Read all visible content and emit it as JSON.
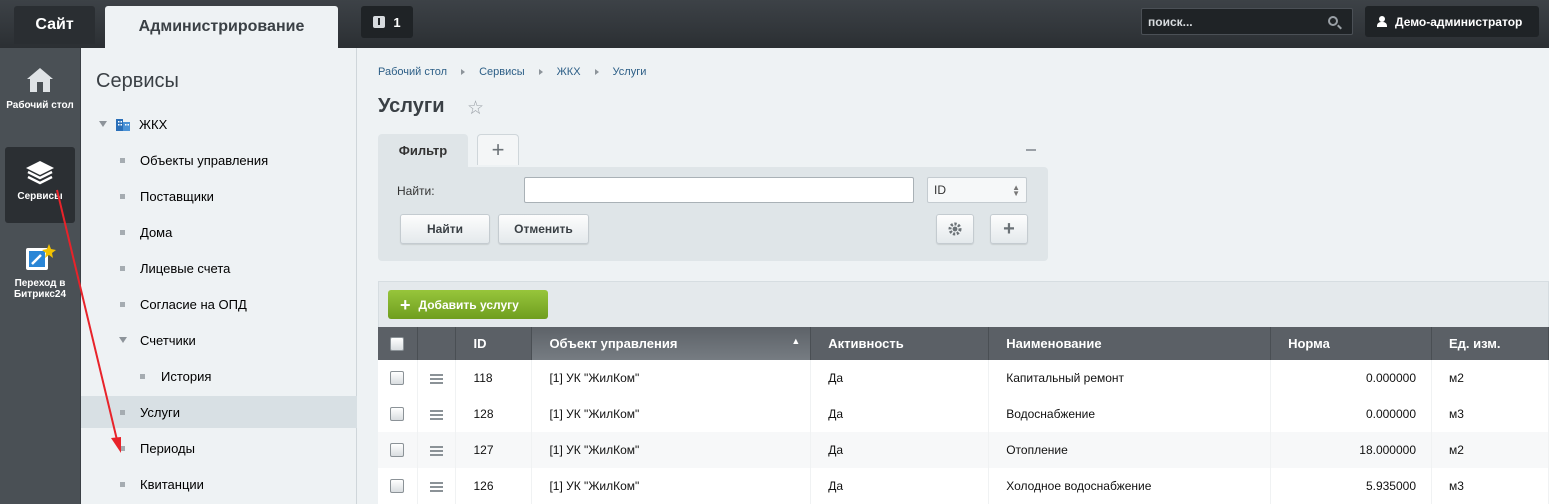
{
  "topbar": {
    "tab_site": "Сайт",
    "tab_admin": "Администрирование",
    "notifications_count": "1",
    "search_placeholder": "поиск...",
    "user_name": "Демо-администратор"
  },
  "rail": {
    "items": [
      {
        "label": "Рабочий стол",
        "icon": "home-icon"
      },
      {
        "label": "Сервисы",
        "icon": "layers-icon",
        "active": true
      },
      {
        "label": "Переход в Битрикс24",
        "icon": "bitrix24-transition-icon"
      }
    ]
  },
  "side": {
    "title": "Сервисы",
    "root": "ЖКХ",
    "items": [
      {
        "label": "Объекты управления"
      },
      {
        "label": "Поставщики"
      },
      {
        "label": "Дома"
      },
      {
        "label": "Лицевые счета"
      },
      {
        "label": "Согласие на ОПД"
      },
      {
        "label": "Счетчики",
        "expanded": true
      },
      {
        "label": "История",
        "child": true
      },
      {
        "label": "Услуги",
        "active": true
      },
      {
        "label": "Периоды"
      },
      {
        "label": "Квитанции"
      }
    ]
  },
  "main": {
    "breadcrumbs": [
      "Рабочий стол",
      "Сервисы",
      "ЖКХ",
      "Услуги"
    ],
    "title": "Услуги",
    "filter": {
      "tab_label": "Фильтр",
      "find_label": "Найти:",
      "find_value": "",
      "field_select": "ID",
      "btn_find": "Найти",
      "btn_cancel": "Отменить"
    },
    "add_button": "Добавить услугу",
    "table": {
      "columns": [
        "ID",
        "Объект управления",
        "Активность",
        "Наименование",
        "Норма",
        "Ед. изм."
      ],
      "rows": [
        {
          "id": "118",
          "object": "[1] УК \"ЖилКом\"",
          "active": "Да",
          "name": "Капитальный ремонт",
          "norm": "0.000000",
          "unit": "м2"
        },
        {
          "id": "128",
          "object": "[1] УК \"ЖилКом\"",
          "active": "Да",
          "name": "Водоснабжение",
          "norm": "0.000000",
          "unit": "м3"
        },
        {
          "id": "127",
          "object": "[1] УК \"ЖилКом\"",
          "active": "Да",
          "name": "Отопление",
          "norm": "18.000000",
          "unit": "м2"
        },
        {
          "id": "126",
          "object": "[1] УК \"ЖилКом\"",
          "active": "Да",
          "name": "Холодное водоснабжение",
          "norm": "5.935000",
          "unit": "м3"
        }
      ]
    }
  },
  "colors": {
    "topbar": "#2b2f33",
    "rail": "#4a5055",
    "add_button": "#7fae2a",
    "header": "#5b6066",
    "annotation_arrow": "#e8232a"
  }
}
